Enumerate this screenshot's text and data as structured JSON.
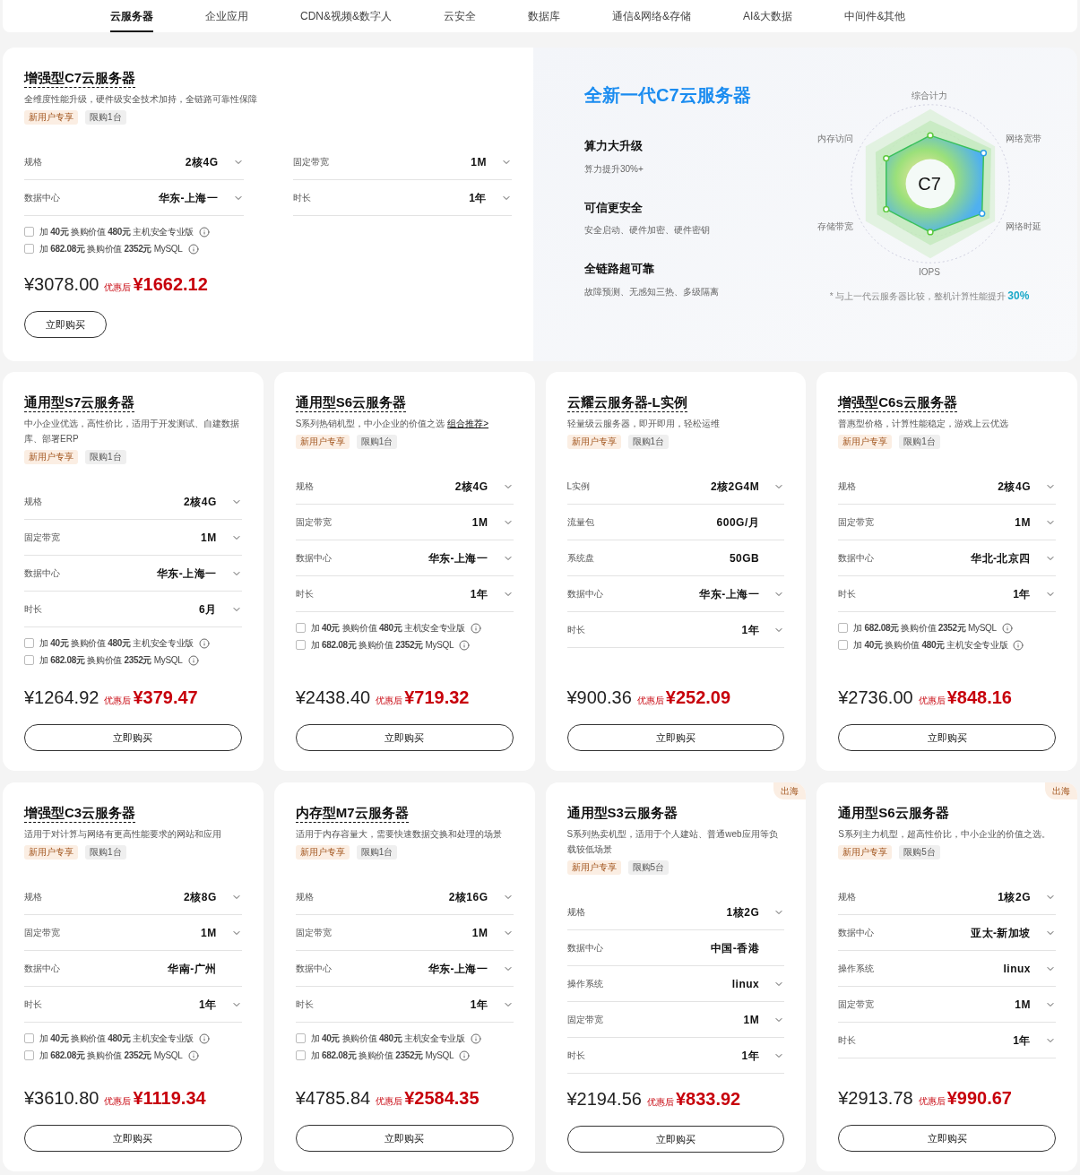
{
  "tabs": [
    {
      "label": "云服务器",
      "selected": true
    },
    {
      "label": "企业应用",
      "selected": false
    },
    {
      "label": "CDN&视频&数字人",
      "selected": false
    },
    {
      "label": "云安全",
      "selected": false
    },
    {
      "label": "数据库",
      "selected": false
    },
    {
      "label": "通信&网络&存储",
      "selected": false
    },
    {
      "label": "AI&大数据",
      "selected": false
    },
    {
      "label": "中间件&其他",
      "selected": false
    }
  ],
  "featured": {
    "card": {
      "title": "增强型C7云服务器",
      "underlined": true,
      "desc": "全维度性能升级，硬件级安全技术加持，全链路可靠性保障",
      "tags": [
        {
          "label": "新用户专享",
          "kind": "new"
        },
        {
          "label": "限购1台",
          "kind": "limit"
        }
      ],
      "fields": [
        {
          "label": "规格",
          "value": "2核4G",
          "dropdown": true
        },
        {
          "label": "固定带宽",
          "value": "1M",
          "dropdown": true
        },
        {
          "label": "数据中心",
          "value": "华东-上海一",
          "dropdown": true
        },
        {
          "label": "时长",
          "value": "1年",
          "dropdown": true
        }
      ],
      "addons": [
        {
          "text": "加 **40元** 换购价值 **480元** 主机安全专业版",
          "checked": false
        },
        {
          "text": "加 **682.08元** 换购价值 **2352元** MySQL",
          "checked": false
        }
      ],
      "original_price": "¥3078.00",
      "discount_label": "优惠后",
      "discount_price": "¥1662.12",
      "buy_button": "立即购买"
    },
    "promo": {
      "title": "全新一代C7云服务器",
      "features": [
        {
          "title": "算力大升级",
          "desc": "算力提升30%+"
        },
        {
          "title": "可信更安全",
          "desc": "安全启动、硬件加密、硬件密钥"
        },
        {
          "title": "全链路超可靠",
          "desc": "故障预测、无感知三热、多级隔离"
        }
      ],
      "radar_labels": [
        "综合计力",
        "网络宽带",
        "网络时延",
        "IOPS",
        "存储带宽",
        "内存访问"
      ],
      "radar_center": "C7",
      "footnote": "* 与上一代云服务器比较，整机计算性能提升",
      "footnote_highlight": "30%"
    }
  },
  "cards": [
    {
      "title": "通用型S7云服务器",
      "underlined": true,
      "desc": "中小企业优选，高性价比，适用于开发测试、自建数据库、部署ERP",
      "tags": [
        {
          "label": "新用户专享",
          "kind": "new"
        },
        {
          "label": "限购1台",
          "kind": "limit"
        }
      ],
      "fields": [
        {
          "label": "规格",
          "value": "2核4G",
          "dropdown": true
        },
        {
          "label": "固定带宽",
          "value": "1M",
          "dropdown": true
        },
        {
          "label": "数据中心",
          "value": "华东-上海一",
          "dropdown": true
        },
        {
          "label": "时长",
          "value": "6月",
          "dropdown": true
        }
      ],
      "addons": [
        {
          "text": "加 **40元** 换购价值 **480元** 主机安全专业版",
          "checked": false
        },
        {
          "text": "加 **682.08元** 换购价值 **2352元** MySQL",
          "checked": false
        }
      ],
      "original_price": "¥1264.92",
      "discount_label": "优惠后",
      "discount_price": "¥379.47",
      "buy_button": "立即购买"
    },
    {
      "title": "通用型S6云服务器",
      "underlined": true,
      "desc": "S系列热销机型，中小企业的价值之选",
      "link": "组合推荐>",
      "tags": [
        {
          "label": "新用户专享",
          "kind": "new"
        },
        {
          "label": "限购1台",
          "kind": "limit"
        }
      ],
      "fields": [
        {
          "label": "规格",
          "value": "2核4G",
          "dropdown": true
        },
        {
          "label": "固定带宽",
          "value": "1M",
          "dropdown": true
        },
        {
          "label": "数据中心",
          "value": "华东-上海一",
          "dropdown": true
        },
        {
          "label": "时长",
          "value": "1年",
          "dropdown": true
        }
      ],
      "addons": [
        {
          "text": "加 **40元** 换购价值 **480元** 主机安全专业版",
          "checked": false
        },
        {
          "text": "加 **682.08元** 换购价值 **2352元** MySQL",
          "checked": false
        }
      ],
      "original_price": "¥2438.40",
      "discount_label": "优惠后",
      "discount_price": "¥719.32",
      "buy_button": "立即购买"
    },
    {
      "title": "云耀云服务器-L实例",
      "underlined": true,
      "desc": "轻量级云服务器，即开即用，轻松运维",
      "tags": [
        {
          "label": "新用户专享",
          "kind": "new"
        },
        {
          "label": "限购1台",
          "kind": "limit"
        }
      ],
      "fields": [
        {
          "label": "L实例",
          "value": "2核2G4M",
          "dropdown": true
        },
        {
          "label": "流量包",
          "value": "600G/月",
          "dropdown": false
        },
        {
          "label": "系统盘",
          "value": "50GB",
          "dropdown": false
        },
        {
          "label": "数据中心",
          "value": "华东-上海一",
          "dropdown": true
        },
        {
          "label": "时长",
          "value": "1年",
          "dropdown": true
        }
      ],
      "original_price": "¥900.36",
      "discount_label": "优惠后",
      "discount_price": "¥252.09",
      "buy_button": "立即购买"
    },
    {
      "title": "增强型C6s云服务器",
      "underlined": true,
      "desc": "普惠型价格，计算性能稳定，游戏上云优选",
      "tags": [
        {
          "label": "新用户专享",
          "kind": "new"
        },
        {
          "label": "限购1台",
          "kind": "limit"
        }
      ],
      "fields": [
        {
          "label": "规格",
          "value": "2核4G",
          "dropdown": true
        },
        {
          "label": "固定带宽",
          "value": "1M",
          "dropdown": true
        },
        {
          "label": "数据中心",
          "value": "华北-北京四",
          "dropdown": true
        },
        {
          "label": "时长",
          "value": "1年",
          "dropdown": true
        }
      ],
      "addons": [
        {
          "text": "加 **682.08元** 换购价值 **2352元** MySQL",
          "checked": false
        },
        {
          "text": "加 **40元** 换购价值 **480元** 主机安全专业版",
          "checked": false
        }
      ],
      "original_price": "¥2736.00",
      "discount_label": "优惠后",
      "discount_price": "¥848.16",
      "buy_button": "立即购买"
    },
    {
      "title": "增强型C3云服务器",
      "underlined": true,
      "desc": "适用于对计算与网络有更高性能要求的网站和应用",
      "tags": [
        {
          "label": "新用户专享",
          "kind": "new"
        },
        {
          "label": "限购1台",
          "kind": "limit"
        }
      ],
      "fields": [
        {
          "label": "规格",
          "value": "2核8G",
          "dropdown": true
        },
        {
          "label": "固定带宽",
          "value": "1M",
          "dropdown": true
        },
        {
          "label": "数据中心",
          "value": "华南-广州",
          "dropdown": false
        },
        {
          "label": "时长",
          "value": "1年",
          "dropdown": true
        }
      ],
      "addons": [
        {
          "text": "加 **40元** 换购价值 **480元** 主机安全专业版",
          "checked": false
        },
        {
          "text": "加 **682.08元** 换购价值 **2352元** MySQL",
          "checked": false
        }
      ],
      "original_price": "¥3610.80",
      "discount_label": "优惠后",
      "discount_price": "¥1119.34",
      "buy_button": "立即购买"
    },
    {
      "title": "内存型M7云服务器",
      "underlined": true,
      "desc": "适用于内存容量大，需要快速数据交换和处理的场景",
      "tags": [
        {
          "label": "新用户专享",
          "kind": "new"
        },
        {
          "label": "限购1台",
          "kind": "limit"
        }
      ],
      "fields": [
        {
          "label": "规格",
          "value": "2核16G",
          "dropdown": true
        },
        {
          "label": "固定带宽",
          "value": "1M",
          "dropdown": true
        },
        {
          "label": "数据中心",
          "value": "华东-上海一",
          "dropdown": true
        },
        {
          "label": "时长",
          "value": "1年",
          "dropdown": true
        }
      ],
      "addons": [
        {
          "text": "加 **40元** 换购价值 **480元** 主机安全专业版",
          "checked": false
        },
        {
          "text": "加 **682.08元** 换购价值 **2352元** MySQL",
          "checked": false
        }
      ],
      "original_price": "¥4785.84",
      "discount_label": "优惠后",
      "discount_price": "¥2584.35",
      "buy_button": "立即购买"
    },
    {
      "title": "通用型S3云服务器",
      "underlined": false,
      "corner_badge": "出海",
      "desc": "S系列热卖机型，适用于个人建站、普通web应用等负载较低场景",
      "tags": [
        {
          "label": "新用户专享",
          "kind": "new"
        },
        {
          "label": "限购5台",
          "kind": "limit"
        }
      ],
      "fields": [
        {
          "label": "规格",
          "value": "1核2G",
          "dropdown": true
        },
        {
          "label": "数据中心",
          "value": "中国-香港",
          "dropdown": false
        },
        {
          "label": "操作系统",
          "value": "linux",
          "dropdown": true
        },
        {
          "label": "固定带宽",
          "value": "1M",
          "dropdown": true
        },
        {
          "label": "时长",
          "value": "1年",
          "dropdown": true
        }
      ],
      "original_price": "¥2194.56",
      "discount_label": "优惠后",
      "discount_price": "¥833.92",
      "buy_button": "立即购买"
    },
    {
      "title": "通用型S6云服务器",
      "underlined": false,
      "corner_badge": "出海",
      "desc": "S系列主力机型，超高性价比，中小企业的价值之选。",
      "tags": [
        {
          "label": "新用户专享",
          "kind": "new"
        },
        {
          "label": "限购5台",
          "kind": "limit"
        }
      ],
      "fields": [
        {
          "label": "规格",
          "value": "1核2G",
          "dropdown": true
        },
        {
          "label": "数据中心",
          "value": "亚太-新加坡",
          "dropdown": true
        },
        {
          "label": "操作系统",
          "value": "linux",
          "dropdown": true
        },
        {
          "label": "固定带宽",
          "value": "1M",
          "dropdown": true
        },
        {
          "label": "时长",
          "value": "1年",
          "dropdown": true
        }
      ],
      "original_price": "¥2913.78",
      "discount_label": "优惠后",
      "discount_price": "¥990.67",
      "buy_button": "立即购买"
    }
  ]
}
